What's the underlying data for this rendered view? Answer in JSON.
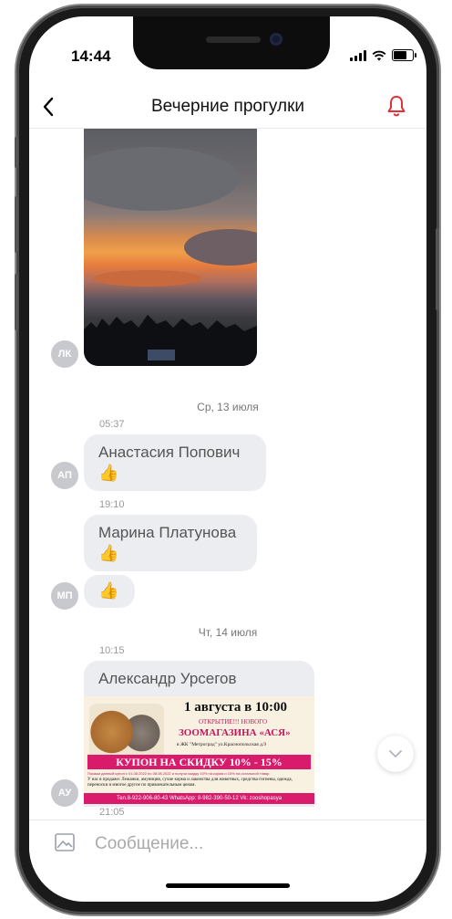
{
  "status_bar": {
    "time": "14:44"
  },
  "header": {
    "title": "Вечерние прогулки",
    "back_icon": "chevron-left-icon",
    "bell_icon": "bell-icon",
    "accent": "#e0303a"
  },
  "messages": {
    "m1": {
      "avatar": "ЛК"
    },
    "sep1": {
      "date": "Ср, 13 июля"
    },
    "m2": {
      "time": "05:37",
      "author": "Анастасия Попович",
      "emoji": "👍",
      "avatar": "АП"
    },
    "m3": {
      "time": "19:10",
      "author": "Марина Платунова",
      "emoji": "👍",
      "emoji2": "👍",
      "avatar": "МП"
    },
    "sep2": {
      "date": "Чт, 14 июля"
    },
    "m4": {
      "time": "10:15",
      "author": "Александр Урсегов",
      "avatar": "АУ",
      "ad": {
        "date_line": "1 августа в 10:00",
        "opening": "ОТКРЫТИЕ!!! НОВОГО",
        "shop": "ЗООМАГАЗИНА «АСЯ»",
        "address": "в ЖК \"Метроград\" ул.Краснопольская д.9",
        "coupon": "КУПОН НА СКИДКУ 10% - 15%",
        "fine_print": "Покажи данный купон с 01.08.2022 по 08.08.2022 и получи скидку 10% на корма и 15% на остальной товар.",
        "sale": "У нас в продаже: Лежанки, амуниция, сухие корма и лакомства для животных, средства гигиены, одежда, переноски и многое другое по привлекательным ценам.",
        "contacts": "Тел.8-922-906-80-43  WhatsApp: 8-982-390-50-12  Vk: zooshopasya"
      }
    },
    "last_time": "21:05"
  },
  "composer": {
    "placeholder": "Сообщение...",
    "value": ""
  }
}
